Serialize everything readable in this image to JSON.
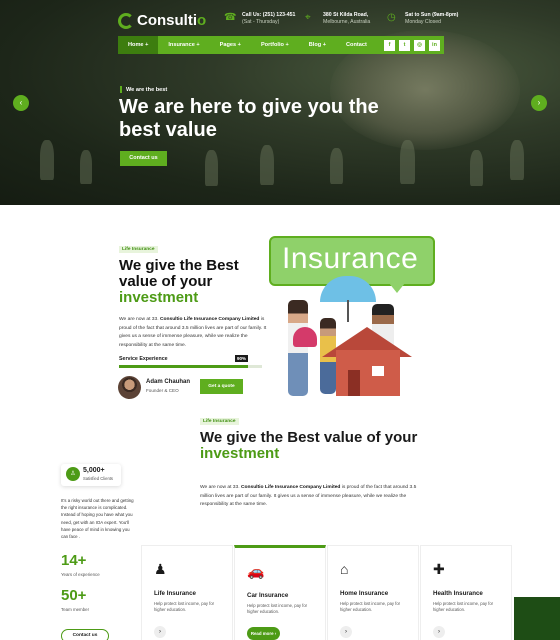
{
  "brand": {
    "name_main": "Consulti",
    "name_accent": "o"
  },
  "header": {
    "phone": {
      "line1": "Call Us: (251) 123-451",
      "line2": "(Sat - Thursday)"
    },
    "address": {
      "line1": "380 St Kilda Road,",
      "line2": "Melbourne, Australia"
    },
    "hours": {
      "line1": "Sat to Sun (9am-8pm)",
      "line2": "Monday Closed"
    }
  },
  "nav": {
    "items": [
      "Home +",
      "Insurance +",
      "Pages +",
      "Portfolio +",
      "Blog +",
      "Contact"
    ],
    "socials": [
      "f",
      "t",
      "◎",
      "in"
    ]
  },
  "hero": {
    "tagline": "We are the best",
    "title": "We are here to give you the best value",
    "cta": "Contact us",
    "prev": "‹",
    "next": "›"
  },
  "about": {
    "badge": "Life Insurance",
    "title_pre": "We give the Best value of your ",
    "title_accent": "investment",
    "para_pre": "We are now at 33. ",
    "para_bold": "Consultio Life Insurance Company Limited",
    "para_post": " is proud of the fact that around 3.5 million lives are part of our family. It gives us a sense of immense pleasure, while we realize the responsibility at the same time.",
    "skill": {
      "label": "Service Experience",
      "percent_text": "90%",
      "percent": 0.9
    },
    "person": {
      "name": "Adam Chauhan",
      "role": "Founder & CEO"
    },
    "quote_button": "Get a quote",
    "illustration_text": "Insurance"
  },
  "second": {
    "badge": "Life Insurance",
    "title_pre": "We give the Best value of your ",
    "title_accent": "investment",
    "para_pre": "We are now at 33. ",
    "para_bold": "Consultio Life Insurance Company Limited",
    "para_post": " is proud of the fact that around 3.5 million lives are part of our family. It gives us a sense of immense pleasure, while we realize the responsibility at the same time."
  },
  "sidebar": {
    "clients_count": "5,000+",
    "clients_label": "Satisfied Clients",
    "clients_icon": "♙",
    "text": "It's a risky world out there and getting the right insurance is complicated. Instead of hoping you have what you need, get with an IOA expert. You'll have peace of mind in knowing you can face .",
    "stats": [
      {
        "num": "14+",
        "label": "Years of experience"
      },
      {
        "num": "50+",
        "label": "Team member"
      }
    ],
    "contact_button": "Contact us"
  },
  "services": [
    {
      "icon": "life-insurance-icon",
      "glyph": "♟",
      "title": "Life Insurance",
      "desc": "Help protect lost income, pay for higher education.",
      "action": "›"
    },
    {
      "icon": "car-insurance-icon",
      "glyph": "🚗",
      "title": "Car Insurance",
      "desc": "Help protect lost income, pay for higher education.",
      "action": "Read more ›"
    },
    {
      "icon": "home-insurance-icon",
      "glyph": "⌂",
      "title": "Home Insurance",
      "desc": "Help protect lost income, pay for higher education.",
      "action": "›"
    },
    {
      "icon": "health-insurance-icon",
      "glyph": "✚",
      "title": "Health Insurance",
      "desc": "Help protect lost income, pay for higher education.",
      "action": "›"
    }
  ],
  "colors": {
    "accent": "#5fae1f",
    "accent_dark": "#3d7d0f",
    "dark_green": "#1e4d15"
  }
}
